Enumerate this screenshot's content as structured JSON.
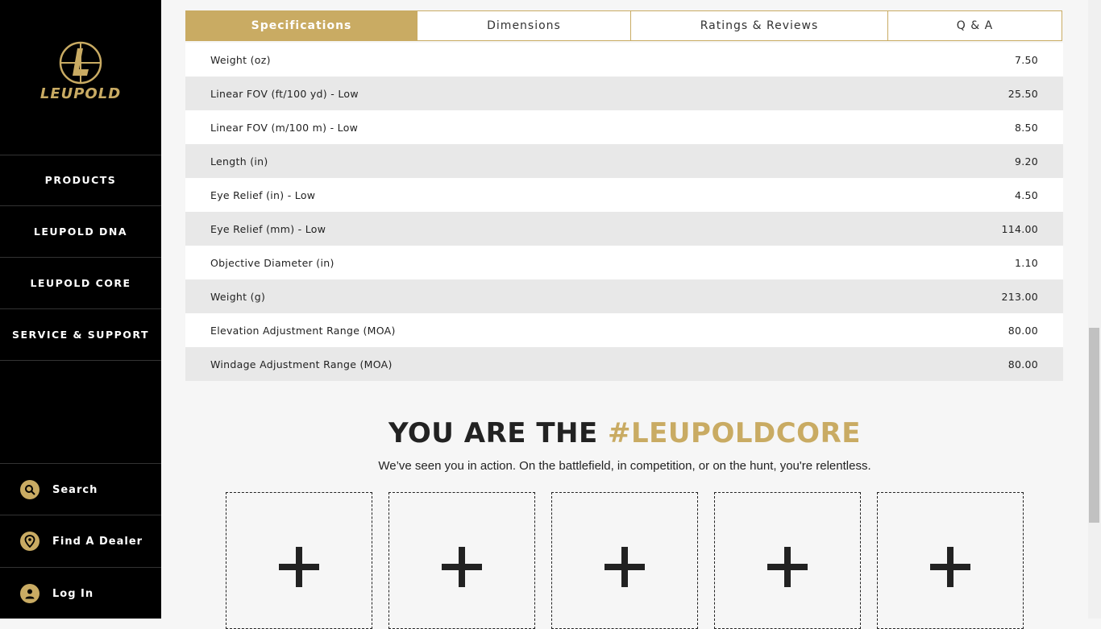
{
  "brand": {
    "name": "LEUPOLD",
    "accent_color": "#c9ab63",
    "logo_icon": "leupold-reticle-logo"
  },
  "sidebar": {
    "nav": [
      {
        "label": "PRODUCTS"
      },
      {
        "label": "LEUPOLD DNA"
      },
      {
        "label": "LEUPOLD CORE"
      },
      {
        "label": "SERVICE & SUPPORT"
      }
    ],
    "utilities": [
      {
        "label": "Search",
        "icon": "search-icon"
      },
      {
        "label": "Find A Dealer",
        "icon": "location-pin-icon"
      },
      {
        "label": "Log In",
        "icon": "user-icon"
      }
    ]
  },
  "tabs": [
    {
      "label": "Specifications",
      "active": true
    },
    {
      "label": "Dimensions",
      "active": false
    },
    {
      "label": "Ratings & Reviews",
      "active": false
    },
    {
      "label": "Q & A",
      "active": false
    }
  ],
  "specs": [
    {
      "name": "Weight (oz)",
      "value": "7.50"
    },
    {
      "name": "Linear FOV (ft/100 yd) - Low",
      "value": "25.50"
    },
    {
      "name": "Linear FOV (m/100 m) - Low",
      "value": "8.50"
    },
    {
      "name": "Length (in)",
      "value": "9.20"
    },
    {
      "name": "Eye Relief (in) - Low",
      "value": "4.50"
    },
    {
      "name": "Eye Relief (mm) - Low",
      "value": "114.00"
    },
    {
      "name": "Objective Diameter (in)",
      "value": "1.10"
    },
    {
      "name": "Weight (g)",
      "value": "213.00"
    },
    {
      "name": "Elevation Adjustment Range (MOA)",
      "value": "80.00"
    },
    {
      "name": "Windage Adjustment Range (MOA)",
      "value": "80.00"
    }
  ],
  "core_section": {
    "title_prefix": "YOU ARE THE ",
    "title_hashtag": "#LEUPOLDCORE",
    "subtitle": "We’ve seen you in action. On the battlefield, in competition, or on the hunt, you're relentless.",
    "tiles": [
      {
        "icon": "plus-icon"
      },
      {
        "icon": "plus-icon"
      },
      {
        "icon": "plus-icon"
      },
      {
        "icon": "plus-icon"
      },
      {
        "icon": "plus-icon"
      }
    ]
  }
}
